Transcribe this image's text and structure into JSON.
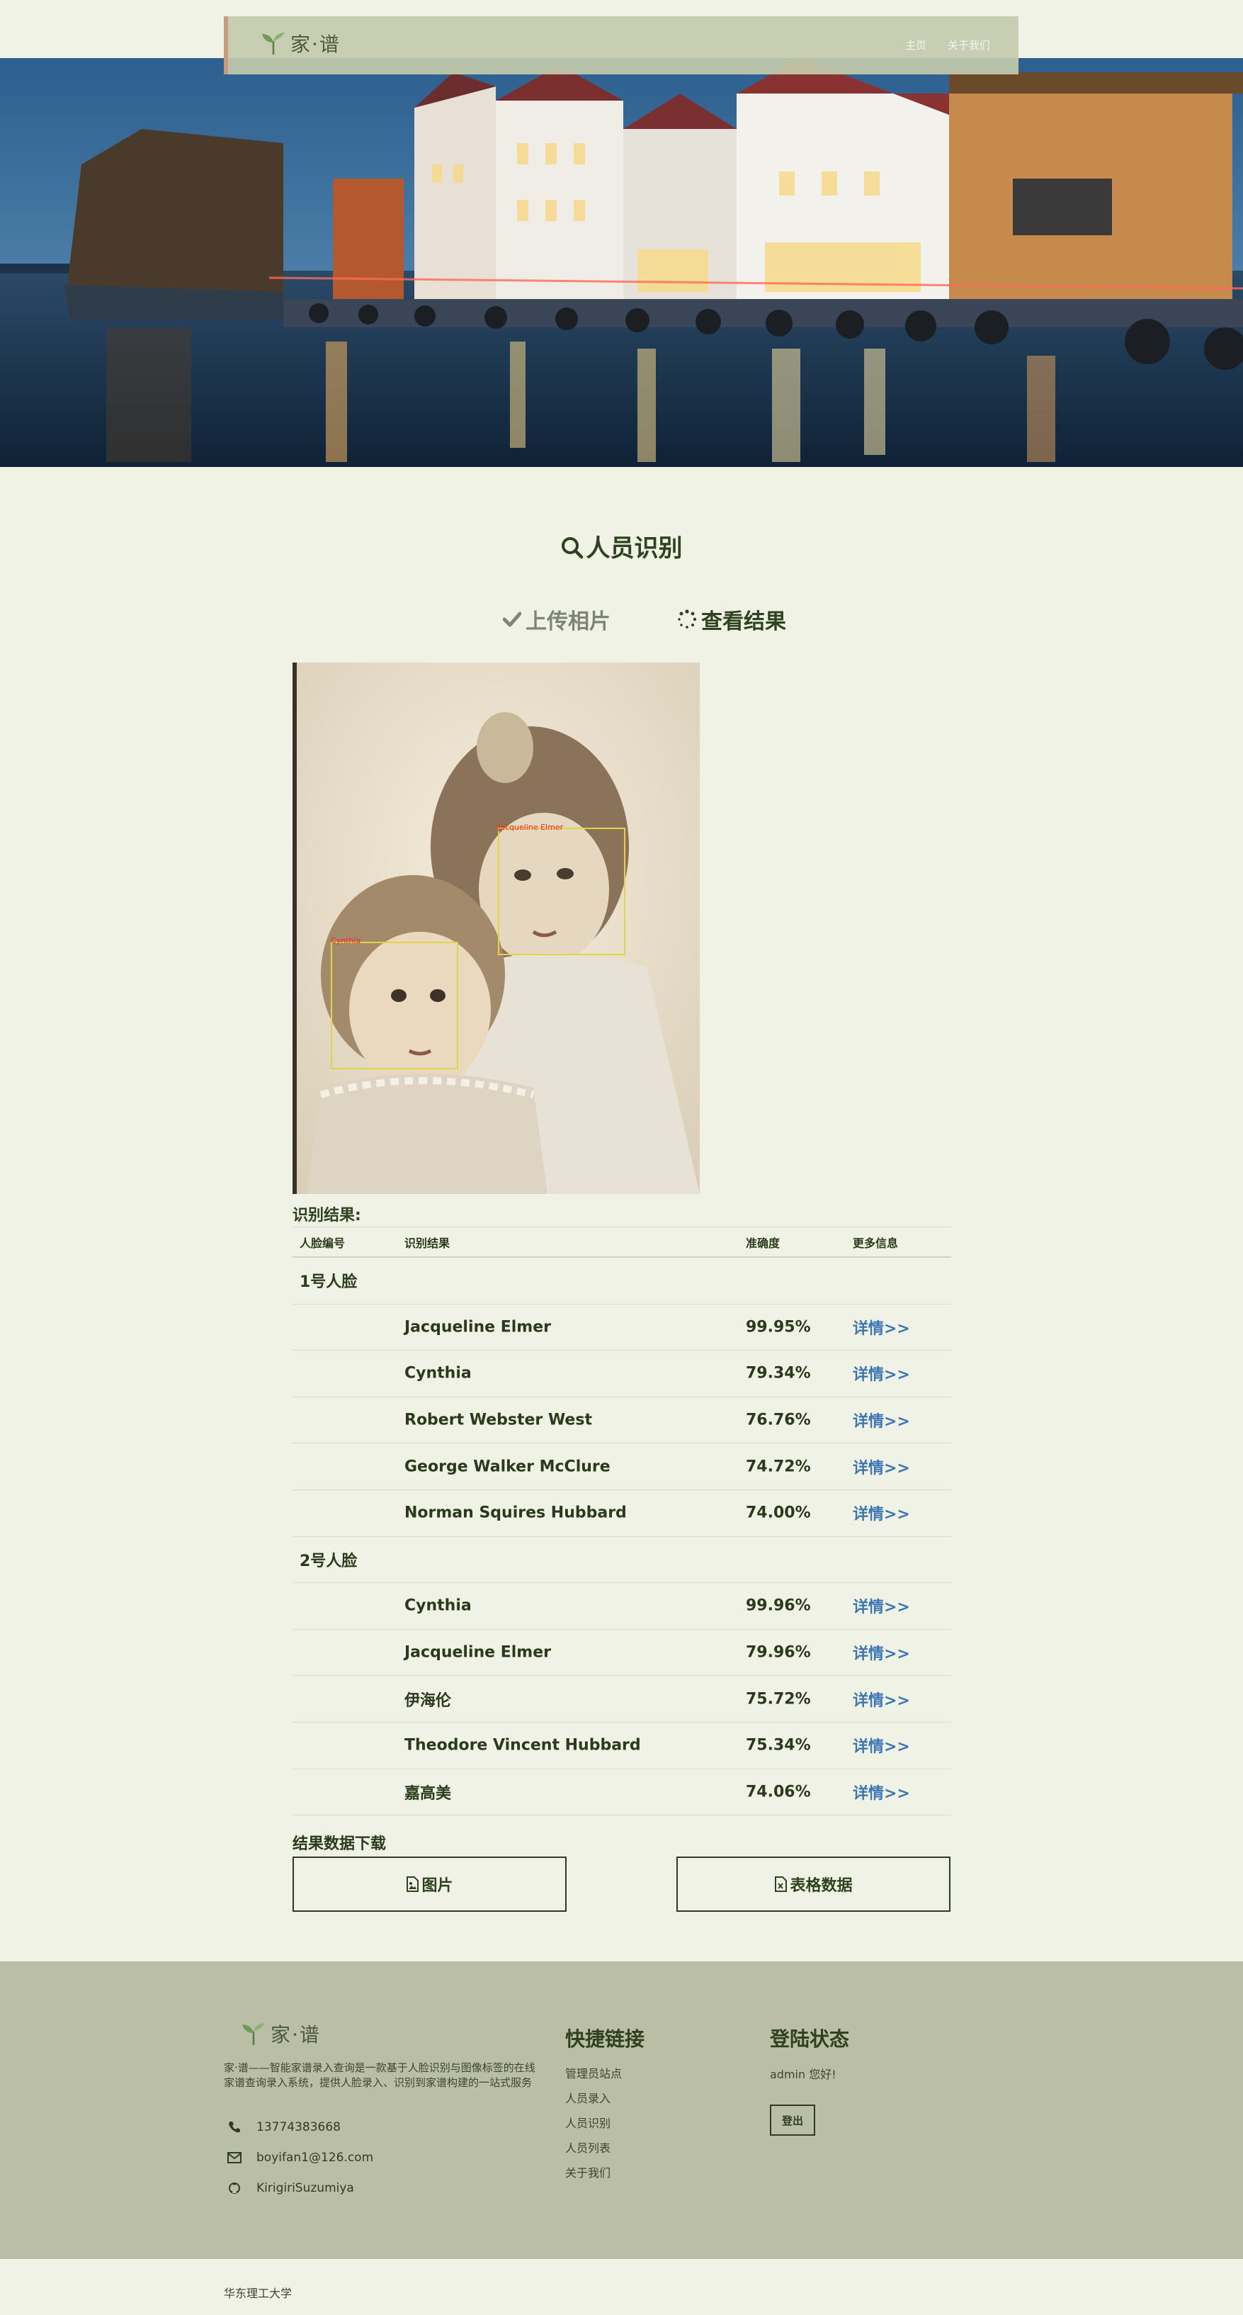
{
  "nav": {
    "logo_text": "家·谱",
    "links": [
      "主页",
      "关于我们"
    ]
  },
  "section": {
    "title": "人员识别",
    "steps": [
      "上传相片",
      "查看结果"
    ]
  },
  "photo": {
    "faces": [
      "Jacqueline Elmer",
      "Cynthia"
    ]
  },
  "results": {
    "title": "识别结果:",
    "headers": [
      "人脸编号",
      "识别结果",
      "准确度",
      "更多信息"
    ],
    "groups": [
      {
        "face": "1号人脸",
        "rows": [
          {
            "name": "Jacqueline Elmer",
            "score": "99.95%",
            "link": "详情>>"
          },
          {
            "name": "Cynthia",
            "score": "79.34%",
            "link": "详情>>"
          },
          {
            "name": "Robert Webster West",
            "score": "76.76%",
            "link": "详情>>"
          },
          {
            "name": "George Walker McClure",
            "score": "74.72%",
            "link": "详情>>"
          },
          {
            "name": "Norman Squires Hubbard",
            "score": "74.00%",
            "link": "详情>>"
          }
        ]
      },
      {
        "face": "2号人脸",
        "rows": [
          {
            "name": "Cynthia",
            "score": "99.96%",
            "link": "详情>>"
          },
          {
            "name": "Jacqueline Elmer",
            "score": "79.96%",
            "link": "详情>>"
          },
          {
            "name": "伊海伦",
            "score": "75.72%",
            "link": "详情>>"
          },
          {
            "name": "Theodore Vincent Hubbard",
            "score": "75.34%",
            "link": "详情>>"
          },
          {
            "name": "嘉高美",
            "score": "74.06%",
            "link": "详情>>"
          }
        ]
      }
    ]
  },
  "download": {
    "title": "结果数据下载",
    "image_label": "图片",
    "table_label": "表格数据"
  },
  "footer": {
    "logo_text": "家·谱",
    "description": "家·谱——智能家谱录入查询是一款基于人脸识别与图像标签的在线家谱查询录入系统，提供人脸录入、识别到家谱构建的一站式服务",
    "phone": "13774383668",
    "email": "boyifan1@126.com",
    "github": "KirigiriSuzumiya",
    "links_title": "快捷链接",
    "links": [
      "管理员站点",
      "人员录入",
      "人员识别",
      "人员列表",
      "关于我们"
    ],
    "status_title": "登陆状态",
    "status_text": "admin 您好!",
    "logout_label": "登出",
    "copyright": "华东理工大学"
  }
}
